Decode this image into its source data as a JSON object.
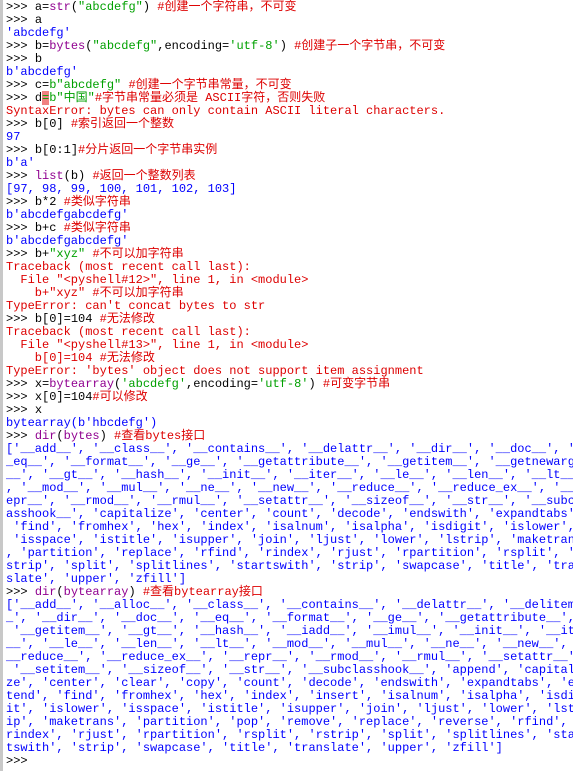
{
  "window": {
    "type": "Python shell"
  },
  "colors": {
    "keyword_builtin": "#900090",
    "string": "#00a000",
    "comment": "#dd0000",
    "output": "#0000ff",
    "error": "#dd0000",
    "highlight": "#f08080"
  },
  "lines": [
    [
      [
        "p",
        ">>> "
      ],
      [
        "t",
        "a="
      ],
      [
        "b",
        "str"
      ],
      [
        "t",
        "("
      ],
      [
        "s",
        "\"abcdefg\""
      ],
      [
        "t",
        ") "
      ],
      [
        "c",
        "#创建一个字符串，不可变"
      ]
    ],
    [
      [
        "p",
        ">>> "
      ],
      [
        "t",
        "a"
      ]
    ],
    [
      [
        "o",
        "'abcdefg'"
      ]
    ],
    [
      [
        "p",
        ">>> "
      ],
      [
        "t",
        "b="
      ],
      [
        "b",
        "bytes"
      ],
      [
        "t",
        "("
      ],
      [
        "s",
        "\"abcdefg\""
      ],
      [
        "t",
        ",encoding="
      ],
      [
        "s",
        "'utf-8'"
      ],
      [
        "t",
        ") "
      ],
      [
        "c",
        "#创建子一个字节串，不可变"
      ]
    ],
    [
      [
        "p",
        ">>> "
      ],
      [
        "t",
        "b"
      ]
    ],
    [
      [
        "o",
        "b'abcdefg'"
      ]
    ],
    [
      [
        "p",
        ">>> "
      ],
      [
        "t",
        "c="
      ],
      [
        "s",
        "b\"abcdefg\""
      ],
      [
        "t",
        " "
      ],
      [
        "c",
        "#创建一个字节串常量，不可变"
      ]
    ],
    [
      [
        "p",
        ">>> "
      ],
      [
        "t",
        "d"
      ],
      [
        "h",
        "="
      ],
      [
        "s",
        "b\"中国\""
      ],
      [
        "c",
        "#字节串常量必须是 ASCII字符，否则失败"
      ]
    ],
    [
      [
        "e",
        "SyntaxError: bytes can only contain ASCII literal characters."
      ]
    ],
    [
      [
        "p",
        ">>> "
      ],
      [
        "t",
        "b[0] "
      ],
      [
        "c",
        "#索引返回一个整数"
      ]
    ],
    [
      [
        "o",
        "97"
      ]
    ],
    [
      [
        "p",
        ">>> "
      ],
      [
        "t",
        "b[0:1]"
      ],
      [
        "c",
        "#分片返回一个字节串实例"
      ]
    ],
    [
      [
        "o",
        "b'a'"
      ]
    ],
    [
      [
        "p",
        ">>> "
      ],
      [
        "b",
        "list"
      ],
      [
        "t",
        "(b) "
      ],
      [
        "c",
        "#返回一个整数列表"
      ]
    ],
    [
      [
        "o",
        "[97, 98, 99, 100, 101, 102, 103]"
      ]
    ],
    [
      [
        "p",
        ">>> "
      ],
      [
        "t",
        "b*2 "
      ],
      [
        "c",
        "#类似字符串"
      ]
    ],
    [
      [
        "o",
        "b'abcdefgabcdefg'"
      ]
    ],
    [
      [
        "p",
        ">>> "
      ],
      [
        "t",
        "b+c "
      ],
      [
        "c",
        "#类似字符串"
      ]
    ],
    [
      [
        "o",
        "b'abcdefgabcdefg'"
      ]
    ],
    [
      [
        "p",
        ">>> "
      ],
      [
        "t",
        "b+"
      ],
      [
        "s",
        "\"xyz\""
      ],
      [
        "t",
        " "
      ],
      [
        "c",
        "#不可以加字符串"
      ]
    ],
    [
      [
        "e",
        "Traceback (most recent call last):"
      ]
    ],
    [
      [
        "e",
        "  File \"<pyshell#12>\", line 1, in <module>"
      ]
    ],
    [
      [
        "e",
        "    b+\"xyz\" #不可以加字符串"
      ]
    ],
    [
      [
        "e",
        "TypeError: can't concat bytes to str"
      ]
    ],
    [
      [
        "p",
        ">>> "
      ],
      [
        "t",
        "b[0]=104 "
      ],
      [
        "c",
        "#无法修改"
      ]
    ],
    [
      [
        "e",
        "Traceback (most recent call last):"
      ]
    ],
    [
      [
        "e",
        "  File \"<pyshell#13>\", line 1, in <module>"
      ]
    ],
    [
      [
        "e",
        "    b[0]=104 #无法修改"
      ]
    ],
    [
      [
        "e",
        "TypeError: 'bytes' object does not support item assignment"
      ]
    ],
    [
      [
        "p",
        ">>> "
      ],
      [
        "t",
        "x="
      ],
      [
        "b",
        "bytearray"
      ],
      [
        "t",
        "("
      ],
      [
        "s",
        "'abcdefg'"
      ],
      [
        "t",
        ",encoding="
      ],
      [
        "s",
        "'utf-8'"
      ],
      [
        "t",
        ") "
      ],
      [
        "c",
        "#可变字节串"
      ]
    ],
    [
      [
        "p",
        ">>> "
      ],
      [
        "t",
        "x[0]=104"
      ],
      [
        "c",
        "#可以修改"
      ]
    ],
    [
      [
        "p",
        ">>> "
      ],
      [
        "t",
        "x"
      ]
    ],
    [
      [
        "o",
        "bytearray(b'hbcdefg')"
      ]
    ],
    [
      [
        "p",
        ">>> "
      ],
      [
        "b",
        "dir"
      ],
      [
        "t",
        "("
      ],
      [
        "b",
        "bytes"
      ],
      [
        "t",
        ") "
      ],
      [
        "c",
        "#查看bytes接口"
      ]
    ],
    [
      [
        "o",
        "['__add__', '__class__', '__contains__', '__delattr__', '__dir__', '__doc__', '_"
      ]
    ],
    [
      [
        "o",
        "_eq__', '__format__', '__ge__', '__getattribute__', '__getitem__', '__getnewargs"
      ]
    ],
    [
      [
        "o",
        "__', '__gt__', '__hash__', '__init__', '__iter__', '__le__', '__len__', '__lt__'"
      ]
    ],
    [
      [
        "o",
        ", '__mod__', '__mul__', '__ne__', '__new__', '__reduce__', '__reduce_ex__', '__r"
      ]
    ],
    [
      [
        "o",
        "epr__', '__rmod__', '__rmul__', '__setattr__', '__sizeof__', '__str__', '__subcl"
      ]
    ],
    [
      [
        "o",
        "asshook__', 'capitalize', 'center', 'count', 'decode', 'endswith', 'expandtabs',"
      ]
    ],
    [
      [
        "o",
        " 'find', 'fromhex', 'hex', 'index', 'isalnum', 'isalpha', 'isdigit', 'islower',"
      ]
    ],
    [
      [
        "o",
        " 'isspace', 'istitle', 'isupper', 'join', 'ljust', 'lower', 'lstrip', 'maketrans'"
      ]
    ],
    [
      [
        "o",
        ", 'partition', 'replace', 'rfind', 'rindex', 'rjust', 'rpartition', 'rsplit', 'r"
      ]
    ],
    [
      [
        "o",
        "strip', 'split', 'splitlines', 'startswith', 'strip', 'swapcase', 'title', 'tran"
      ]
    ],
    [
      [
        "o",
        "slate', 'upper', 'zfill']"
      ]
    ],
    [
      [
        "p",
        ">>> "
      ],
      [
        "b",
        "dir"
      ],
      [
        "t",
        "("
      ],
      [
        "b",
        "bytearray"
      ],
      [
        "t",
        ") "
      ],
      [
        "c",
        "#查看bytearray接口"
      ]
    ],
    [
      [
        "o",
        "['__add__', '__alloc__', '__class__', '__contains__', '__delattr__', '__delitem_"
      ]
    ],
    [
      [
        "o",
        "_', '__dir__', '__doc__', '__eq__', '__format__', '__ge__', '__getattribute__',"
      ]
    ],
    [
      [
        "o",
        " '__getitem__', '__gt__', '__hash__', '__iadd__', '__imul__', '__init__', '__iter"
      ]
    ],
    [
      [
        "o",
        "__', '__le__', '__len__', '__lt__', '__mod__', '__mul__', '__ne__', '__new__', '"
      ]
    ],
    [
      [
        "o",
        "__reduce__', '__reduce_ex__', '__repr__', '__rmod__', '__rmul__', '__setattr__',"
      ]
    ],
    [
      [
        "o",
        " '__setitem__', '__sizeof__', '__str__', '__subclasshook__', 'append', 'capitali"
      ]
    ],
    [
      [
        "o",
        "ze', 'center', 'clear', 'copy', 'count', 'decode', 'endswith', 'expandtabs', 'ex"
      ]
    ],
    [
      [
        "o",
        "tend', 'find', 'fromhex', 'hex', 'index', 'insert', 'isalnum', 'isalpha', 'isdig"
      ]
    ],
    [
      [
        "o",
        "it', 'islower', 'isspace', 'istitle', 'isupper', 'join', 'ljust', 'lower', 'lstr"
      ]
    ],
    [
      [
        "o",
        "ip', 'maketrans', 'partition', 'pop', 'remove', 'replace', 'reverse', 'rfind', '"
      ]
    ],
    [
      [
        "o",
        "rindex', 'rjust', 'rpartition', 'rsplit', 'rstrip', 'split', 'splitlines', 'star"
      ]
    ],
    [
      [
        "o",
        "tswith', 'strip', 'swapcase', 'title', 'translate', 'upper', 'zfill']"
      ]
    ],
    [
      [
        "p",
        ">>> "
      ]
    ]
  ]
}
